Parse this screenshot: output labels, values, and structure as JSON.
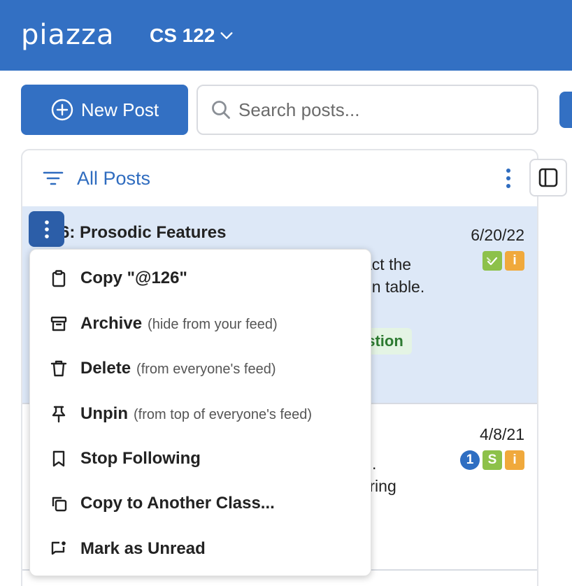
{
  "header": {
    "logo": "piazza",
    "course": "CS 122"
  },
  "toolbar": {
    "new_post_label": "New Post",
    "search_placeholder": "Search posts..."
  },
  "feed": {
    "title": "All Posts",
    "posts": [
      {
        "title_visible": "6: Prosodic Features",
        "date": "6/20/22",
        "snippet_line1": "act the",
        "snippet_line2": "en table.",
        "tag": "estion",
        "badges": [
          "green-check",
          "i"
        ]
      },
      {
        "date": "4/8/21",
        "snippet_line1": ".",
        "snippet_line2": "tring",
        "badges": [
          "1",
          "S",
          "i"
        ]
      }
    ]
  },
  "menu": {
    "items": [
      {
        "label": "Copy \"@126\"",
        "note": "",
        "icon": "clipboard-icon"
      },
      {
        "label": "Archive",
        "note": "(hide from your feed)",
        "icon": "archive-icon"
      },
      {
        "label": "Delete",
        "note": "(from everyone's feed)",
        "icon": "trash-icon"
      },
      {
        "label": "Unpin",
        "note": "(from top of everyone's feed)",
        "icon": "pin-icon"
      },
      {
        "label": "Stop Following",
        "note": "",
        "icon": "bookmark-icon"
      },
      {
        "label": "Copy to Another Class...",
        "note": "",
        "icon": "copy-icon"
      },
      {
        "label": "Mark as Unread",
        "note": "",
        "icon": "mark-unread-icon"
      }
    ]
  },
  "colors": {
    "brand": "#3370c3",
    "selected_post_bg": "#dde8f7",
    "tag_green": "#2d7a31",
    "badge_green": "#8dc14a",
    "badge_orange": "#f0a93c"
  }
}
